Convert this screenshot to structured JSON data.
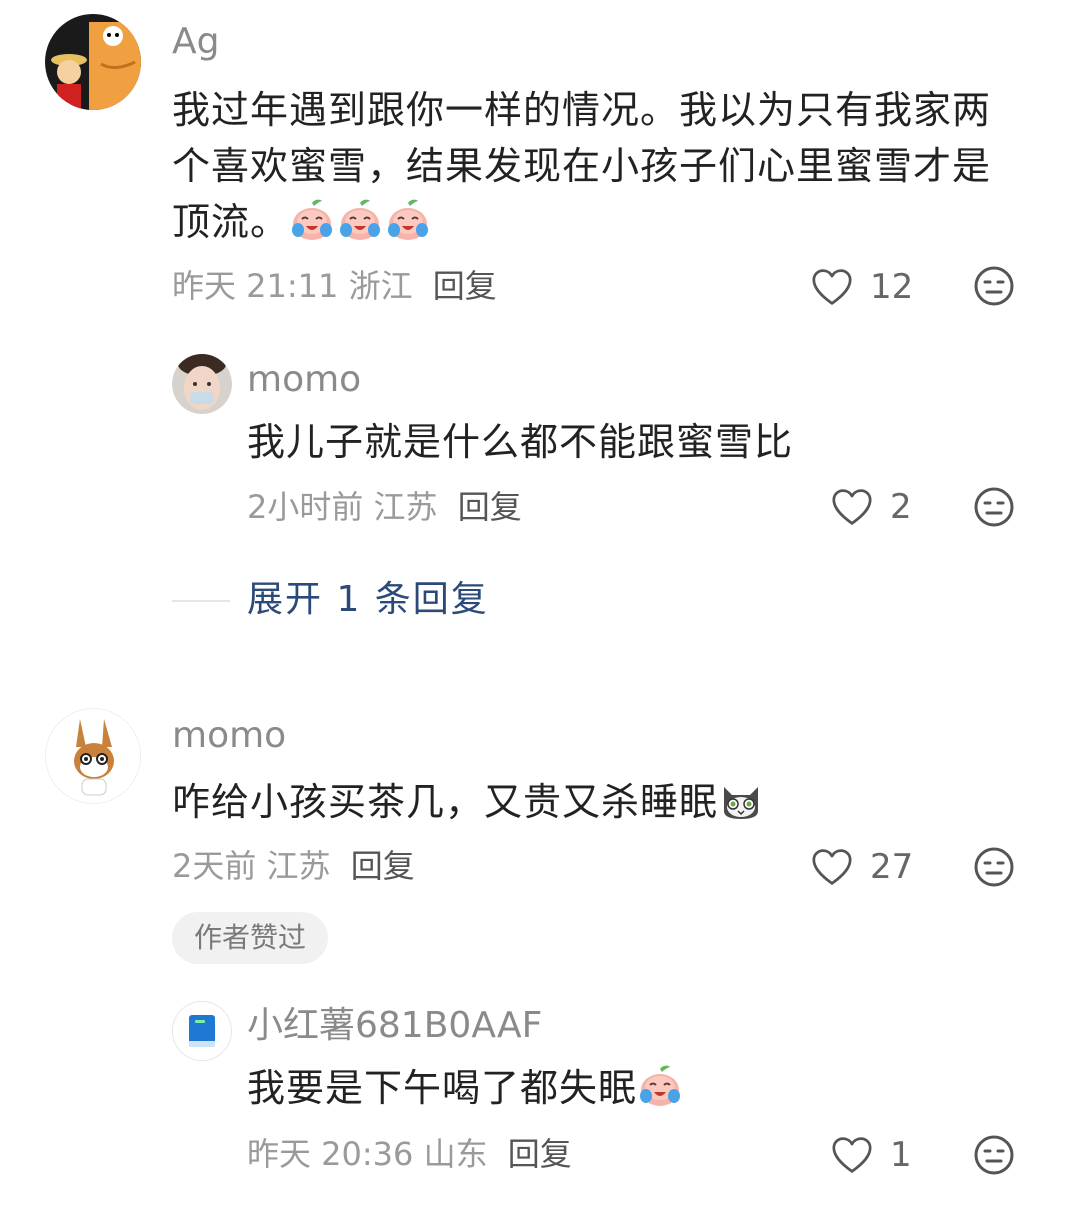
{
  "comments": [
    {
      "username": "Ag",
      "text": "我过年遇到跟你一样的情况。我以为只有我家两个喜欢蜜雪，结果发现在小孩子们心里蜜雪才是顶流。",
      "emoji_icons": [
        "crying-peach-icon",
        "crying-peach-icon",
        "crying-peach-icon"
      ],
      "time": "昨天 21:11",
      "location": "浙江",
      "reply_label": "回复",
      "like_count": "12",
      "replies": [
        {
          "username": "momo",
          "text": "我儿子就是什么都不能跟蜜雪比",
          "time": "2小时前",
          "location": "江苏",
          "reply_label": "回复",
          "like_count": "2"
        }
      ],
      "expand_label": "展开 1 条回复"
    },
    {
      "username": "momo",
      "text": "咋给小孩买茶几，又贵又杀睡眠",
      "emoji_icons": [
        "shocked-cat-icon"
      ],
      "time": "2天前",
      "location": "江苏",
      "reply_label": "回复",
      "like_count": "27",
      "author_badge": "作者赞过",
      "replies": [
        {
          "username": "小红薯681B0AAF",
          "text": "我要是下午喝了都失眠",
          "emoji_icons": [
            "crying-peach-icon"
          ],
          "time": "昨天 20:36",
          "location": "山东",
          "reply_label": "回复",
          "like_count": "1"
        }
      ]
    }
  ],
  "colors": {
    "username": "#8a8a8a",
    "meta": "#9a9a9a",
    "expand_link": "#2b4a7a",
    "badge_bg": "#f1f1f1"
  }
}
